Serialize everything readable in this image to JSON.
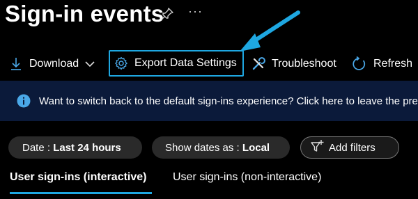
{
  "page": {
    "title": "Sign-in events",
    "more_label": "···"
  },
  "toolbar": {
    "download_label": "Download",
    "export_label": "Export Data Settings",
    "troubleshoot_label": "Troubleshoot",
    "refresh_label": "Refresh"
  },
  "banner": {
    "text": "Want to switch back to the default sign-ins experience? Click here to leave the pre"
  },
  "filters": {
    "date_prefix": "Date : ",
    "date_value": "Last 24 hours",
    "show_prefix": "Show dates as : ",
    "show_value": "Local",
    "add_label": "Add filters"
  },
  "tabs": [
    {
      "label": "User sign-ins (interactive)"
    },
    {
      "label": "User sign-ins (non-interactive)"
    }
  ],
  "colors": {
    "accent": "#1ea7e1",
    "banner_bg": "#0b1a3a",
    "background": "#000000"
  },
  "icons": [
    "pin-icon",
    "more-icon",
    "download-icon",
    "chevron-down-icon",
    "gear-icon",
    "wrench-icon",
    "refresh-icon",
    "info-icon",
    "filter-add-icon",
    "callout-arrow-icon"
  ]
}
